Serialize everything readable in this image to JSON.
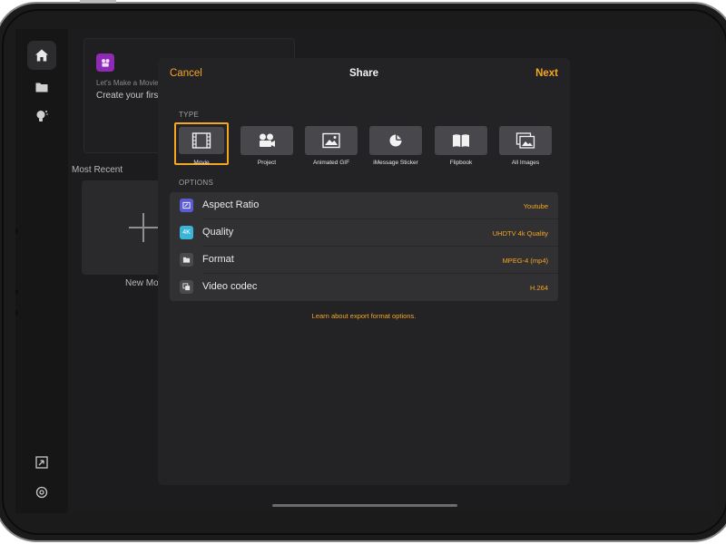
{
  "sidebar": {
    "items": [
      {
        "icon": "home-icon",
        "active": true
      },
      {
        "icon": "folder-icon",
        "active": false
      },
      {
        "icon": "lightbulb-icon",
        "active": false
      }
    ],
    "bottom_items": [
      {
        "icon": "import-icon"
      },
      {
        "icon": "gear-icon"
      }
    ]
  },
  "background": {
    "promo_kicker": "Let's Make a Movie",
    "promo_title": "Create your first Motion Studio.",
    "most_recent_label": "Most Recent",
    "new_movie_label": "New Movie"
  },
  "modal": {
    "cancel_label": "Cancel",
    "title": "Share",
    "next_label": "Next",
    "type_label": "TYPE",
    "types": [
      {
        "label": "Movie",
        "icon": "film-icon",
        "selected": true
      },
      {
        "label": "Project",
        "icon": "movie-camera-icon",
        "selected": false
      },
      {
        "label": "Animated GIF",
        "icon": "image-icon",
        "selected": false
      },
      {
        "label": "iMessage Sticker",
        "icon": "sticker-icon",
        "selected": false
      },
      {
        "label": "Flipbook",
        "icon": "book-icon",
        "selected": false
      },
      {
        "label": "All Images",
        "icon": "images-icon",
        "selected": false
      }
    ],
    "options_label": "OPTIONS",
    "options": [
      {
        "label": "Aspect Ratio",
        "value": "Youtube",
        "icon": "aspect-ratio-icon",
        "icon_color": "#5b5bd6",
        "icon_text": ""
      },
      {
        "label": "Quality",
        "value": "UHDTV 4k Quality",
        "icon": "quality-4k-icon",
        "icon_color": "#3cb4d8",
        "icon_text": "4K"
      },
      {
        "label": "Format",
        "value": "MPEG-4 (mp4)",
        "icon": "folder-icon",
        "icon_color": "#4a4a4e",
        "icon_text": ""
      },
      {
        "label": "Video codec",
        "value": "H.264",
        "icon": "codec-icon",
        "icon_color": "#4a4a4e",
        "icon_text": ""
      }
    ],
    "learn_link": "Learn about export format options."
  },
  "colors": {
    "accent": "#f5a623",
    "modal_bg": "#232325",
    "screen_bg": "#1c1c1e"
  }
}
